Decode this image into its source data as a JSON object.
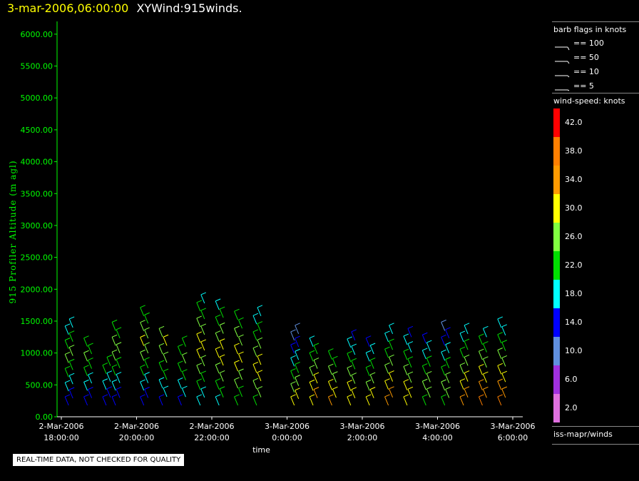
{
  "header": {
    "timestamp": "3-mar-2006,06:00:00",
    "product": "XYWind:915winds."
  },
  "chart_data": {
    "type": "scatter",
    "title": "XYWind:915winds.",
    "xlabel": "time",
    "ylabel": "915 Profiler Altitude (m agl)",
    "ylim": [
      0,
      6200
    ],
    "yticks": [
      "0.00",
      "500.00",
      "1000.00",
      "1500.00",
      "2000.00",
      "2500.00",
      "3000.00",
      "3500.00",
      "4000.00",
      "4500.00",
      "5000.00",
      "5500.00",
      "6000.00"
    ],
    "xticks": [
      {
        "date": "2-Mar-2006",
        "time": "18:00:00"
      },
      {
        "date": "2-Mar-2006",
        "time": "20:00:00"
      },
      {
        "date": "2-Mar-2006",
        "time": "22:00:00"
      },
      {
        "date": "3-Mar-2006",
        "time": "0:00:00"
      },
      {
        "date": "3-Mar-2006",
        "time": "2:00:00"
      },
      {
        "date": "3-Mar-2006",
        "time": "4:00:00"
      },
      {
        "date": "3-Mar-2006",
        "time": "6:00:00"
      }
    ],
    "profiles": [
      {
        "time": "2-Mar-2006 18:15",
        "top": 1400,
        "speeds": [
          12,
          14,
          16,
          18,
          20,
          22,
          24,
          24,
          22,
          20,
          18,
          16
        ]
      },
      {
        "time": "2-Mar-2006 18:45",
        "top": 1100,
        "speeds": [
          14,
          14,
          16,
          18,
          20,
          22,
          24,
          22,
          20
        ]
      },
      {
        "time": "2-Mar-2006 19:15",
        "top": 800,
        "speeds": [
          12,
          14,
          16,
          18,
          20,
          22
        ]
      },
      {
        "time": "2-Mar-2006 19:30",
        "top": 1350,
        "speeds": [
          12,
          14,
          16,
          18,
          20,
          22,
          24,
          26,
          24,
          22,
          20
        ]
      },
      {
        "time": "2-Mar-2006 20:15",
        "top": 1580,
        "speeds": [
          12,
          14,
          16,
          18,
          20,
          22,
          24,
          26,
          28,
          26,
          24,
          22,
          20
        ]
      },
      {
        "time": "2-Mar-2006 20:45",
        "top": 1250,
        "speeds": [
          14,
          16,
          18,
          20,
          22,
          24,
          26,
          28,
          26
        ]
      },
      {
        "time": "2-Mar-2006 21:15",
        "top": 1100,
        "speeds": [
          14,
          16,
          18,
          20,
          22,
          24,
          22,
          20
        ]
      },
      {
        "time": "2-Mar-2006 21:45",
        "top": 1780,
        "speeds": [
          16,
          18,
          20,
          22,
          24,
          26,
          28,
          30,
          28,
          26,
          24,
          22,
          20,
          18
        ]
      },
      {
        "time": "2-Mar-2006 22:15",
        "top": 1680,
        "speeds": [
          18,
          20,
          22,
          24,
          26,
          28,
          30,
          28,
          26,
          24,
          22,
          20,
          18
        ]
      },
      {
        "time": "2-Mar-2006 22:45",
        "top": 1520,
        "speeds": [
          20,
          22,
          24,
          26,
          28,
          30,
          28,
          26,
          24,
          22,
          20
        ]
      },
      {
        "time": "2-Mar-2006 23:15",
        "top": 1580,
        "speeds": [
          22,
          24,
          26,
          28,
          30,
          28,
          26,
          24,
          22,
          20,
          18,
          16
        ]
      },
      {
        "time": "3-Mar-2006 00:15",
        "top": 1300,
        "speeds": [
          30,
          28,
          26,
          24,
          22,
          20,
          18,
          16,
          14,
          12,
          10,
          8
        ]
      },
      {
        "time": "3-Mar-2006 00:45",
        "top": 1100,
        "speeds": [
          30,
          32,
          30,
          28,
          26,
          24,
          22,
          20,
          18
        ]
      },
      {
        "time": "3-Mar-2006 01:15",
        "top": 900,
        "speeds": [
          32,
          30,
          28,
          26,
          24,
          22,
          20
        ]
      },
      {
        "time": "3-Mar-2006 01:45",
        "top": 1200,
        "speeds": [
          28,
          30,
          28,
          26,
          24,
          22,
          20,
          18,
          16,
          14
        ]
      },
      {
        "time": "3-Mar-2006 02:15",
        "top": 1100,
        "speeds": [
          30,
          28,
          26,
          24,
          22,
          20,
          18,
          16,
          14
        ]
      },
      {
        "time": "3-Mar-2006 02:45",
        "top": 1300,
        "speeds": [
          34,
          32,
          30,
          28,
          26,
          24,
          22,
          20,
          18,
          16
        ]
      },
      {
        "time": "3-Mar-2006 03:15",
        "top": 1250,
        "speeds": [
          28,
          30,
          28,
          26,
          24,
          22,
          20,
          18,
          16,
          14
        ]
      },
      {
        "time": "3-Mar-2006 03:45",
        "top": 1150,
        "speeds": [
          22,
          24,
          26,
          24,
          22,
          20,
          18,
          16,
          14
        ]
      },
      {
        "time": "3-Mar-2006 04:15",
        "top": 1350,
        "speeds": [
          22,
          24,
          26,
          24,
          22,
          20,
          18,
          16,
          14,
          12,
          10
        ]
      },
      {
        "time": "3-Mar-2006 04:45",
        "top": 1300,
        "speeds": [
          34,
          32,
          30,
          28,
          26,
          24,
          22,
          20,
          18,
          16
        ]
      },
      {
        "time": "3-Mar-2006 05:15",
        "top": 1250,
        "speeds": [
          36,
          34,
          32,
          30,
          28,
          26,
          24,
          22,
          20,
          18
        ]
      },
      {
        "time": "3-Mar-2006 05:45",
        "top": 1400,
        "speeds": [
          36,
          34,
          32,
          30,
          28,
          26,
          24,
          22,
          20,
          18,
          16
        ]
      }
    ]
  },
  "legend": {
    "barb_title": "barb flags in knots",
    "barb_items": [
      "== 100",
      "== 50",
      "== 10",
      "== 5"
    ],
    "speed_title": "wind-speed: knots",
    "colorbar": [
      {
        "label": "42.0",
        "color": "#ff0000"
      },
      {
        "label": "38.0",
        "color": "#ff7f00"
      },
      {
        "label": "34.0",
        "color": "#ff9a00"
      },
      {
        "label": "30.0",
        "color": "#ffff00"
      },
      {
        "label": "26.0",
        "color": "#80ff40"
      },
      {
        "label": "22.0",
        "color": "#00e000"
      },
      {
        "label": "18.0",
        "color": "#00ffff"
      },
      {
        "label": "14.0",
        "color": "#0000ff"
      },
      {
        "label": "10.0",
        "color": "#6090e0"
      },
      {
        "label": "6.0",
        "color": "#a030e0"
      },
      {
        "label": "2.0",
        "color": "#e070e0"
      }
    ],
    "source": "iss-mapr/winds"
  },
  "disclaimer": "REAL-TIME DATA, NOT CHECKED FOR QUALITY"
}
